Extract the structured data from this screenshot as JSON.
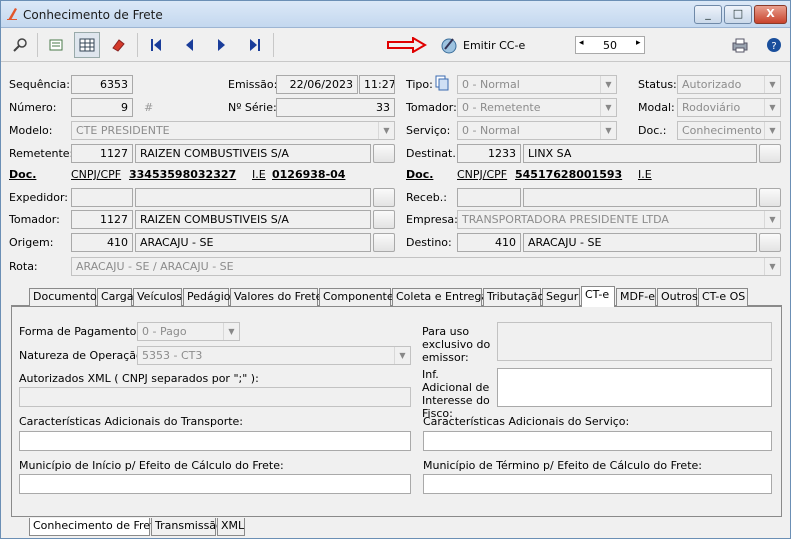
{
  "window": {
    "title": "Conhecimento de Frete",
    "controls": [
      "_",
      "□",
      "X"
    ]
  },
  "toolbar": {
    "emitir_label": "Emitir CC-e",
    "page_value": "50"
  },
  "header": {
    "sequencia_label": "Sequência:",
    "sequencia": "6353",
    "emissao_label": "Emissão:",
    "emissao_date": "22/06/2023",
    "emissao_time": "11:27",
    "tipo_label": "Tipo:",
    "tipo": "0 - Normal",
    "status_label": "Status:",
    "status": "Autorizado",
    "numero_label": "Número:",
    "numero": "9",
    "numero_hash": "#",
    "serie_label": "Nº Série:",
    "serie": "33",
    "tomador_label": "Tomador:",
    "tomador_tipo": "0 - Remetente",
    "modal_label": "Modal:",
    "modal": "Rodoviário",
    "modelo_label": "Modelo:",
    "modelo": "CTE PRESIDENTE",
    "servico_label": "Serviço:",
    "servico": "0 - Normal",
    "doc_label": "Doc.:",
    "doc": "Conhecimento",
    "remetente_label": "Remetente:",
    "remetente_code": "1127",
    "remetente_name": "RAIZEN COMBUSTIVEIS S/A",
    "destinat_label": "Destinat.:",
    "destinat_code": "1233",
    "destinat_name": "LINX SA",
    "doc_link": "Doc.",
    "cnpj_label": "CNPJ/CPF",
    "rem_cnpj": "33453598032327",
    "ie_label": "I.E",
    "rem_ie": "0126938-04",
    "dest_cnpj": "54517628001593",
    "expedidor_label": "Expedidor:",
    "receb_label": "Receb.:",
    "tomador2_label": "Tomador:",
    "tomador_code": "1127",
    "tomador_name": "RAIZEN COMBUSTIVEIS S/A",
    "empresa_label": "Empresa:",
    "empresa": "TRANSPORTADORA PRESIDENTE LTDA",
    "origem_label": "Origem:",
    "origem_code": "410",
    "origem_name": "ARACAJU - SE",
    "destino_label": "Destino:",
    "destino_code": "410",
    "destino_name": "ARACAJU - SE",
    "rota_label": "Rota:",
    "rota": "ARACAJU - SE / ARACAJU - SE"
  },
  "tabs": [
    "Documentos",
    "Carga",
    "Veículos",
    "Pedágio",
    "Valores do Frete",
    "Componentes",
    "Coleta e Entrega",
    "Tributação",
    "Segur",
    "CT-e",
    "MDF-e",
    "Outros",
    "CT-e OS"
  ],
  "cte": {
    "forma_pag_label": "Forma de Pagamento:",
    "forma_pag": "0 - Pago",
    "natureza_label": "Natureza de Operação:",
    "natureza": "5353 - CT3",
    "autorizados_label": "Autorizados XML ( CNPJ separados por \";\" ):",
    "uso_emissor_label": "Para uso exclusivo do emissor:",
    "inf_adic_label": "Inf. Adicional de Interesse do Fisco:",
    "carac_transp_label": "Características Adicionais do Transporte:",
    "carac_serv_label": "Características Adicionais do Serviço:",
    "mun_inicio_label": "Município de Início p/ Efeito de Cálculo do Frete:",
    "mun_termino_label": "Município de Término p/ Efeito de Cálculo do Frete:"
  },
  "bottom_tabs": [
    "Conhecimento de Frete",
    "Transmissão",
    "XML"
  ],
  "colors": {
    "title_bg": "#c4d8ef",
    "close": "#c8432d",
    "nav": "#1a3d9a",
    "arrow": "#e00000"
  }
}
